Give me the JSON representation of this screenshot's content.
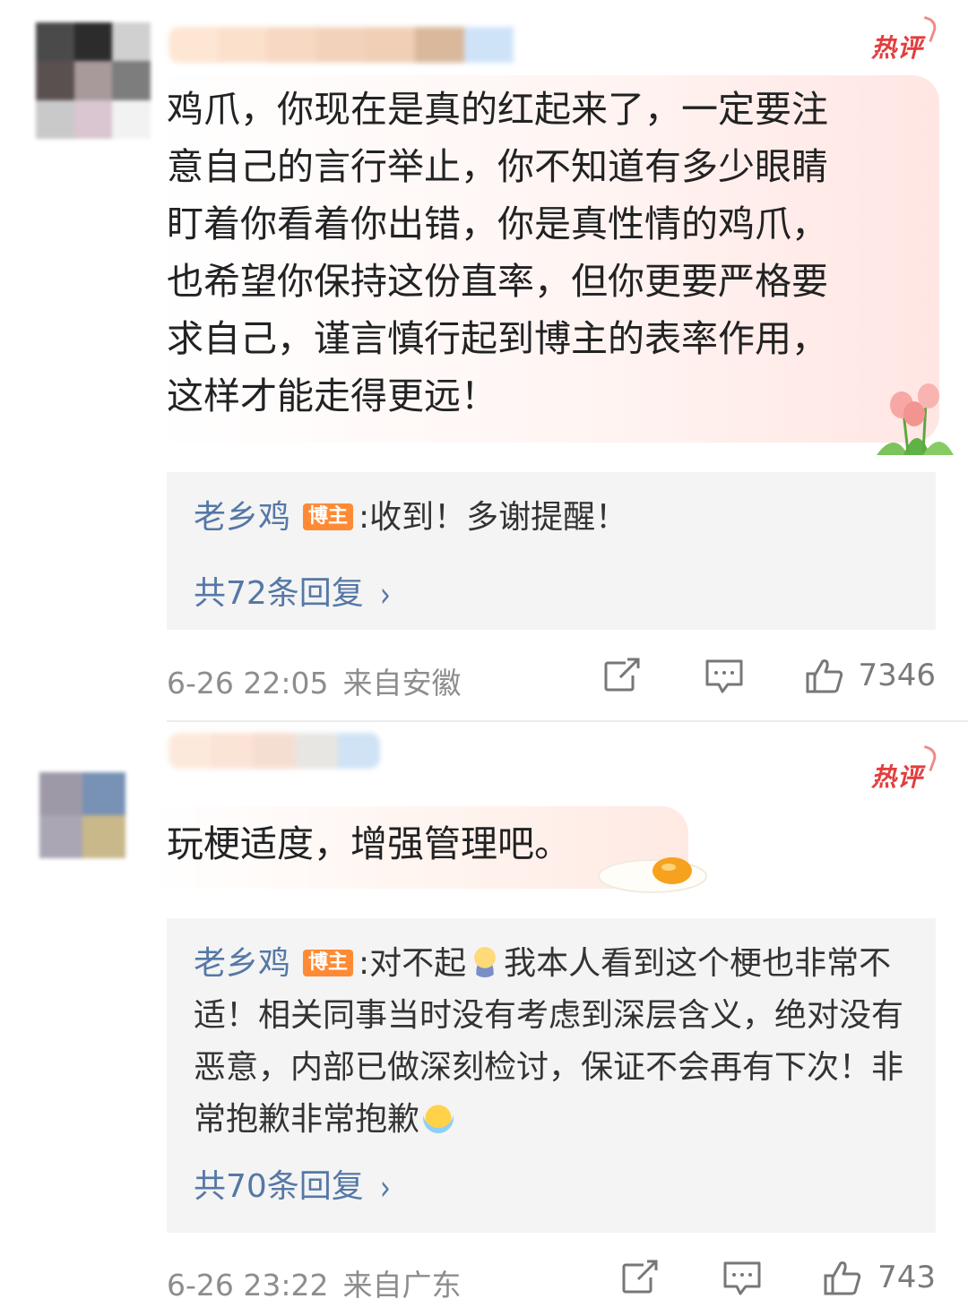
{
  "hot_badge": "热评",
  "comments": [
    {
      "avatar_tiles": [
        "#4a4a4a",
        "#2c2c2c",
        "#d0d0d0",
        "#5a5050",
        "#a89a9a",
        "#7d7d7d",
        "#c9c9c9",
        "#d9c6d0",
        "#f2f2f2"
      ],
      "username_tiles": [
        "#fde6d4",
        "#fbe0cc",
        "#f7d8c2",
        "#f3d2bb",
        "#f0cfb6",
        "#d9b89b",
        "#cfe3f8",
        "#ffffff"
      ],
      "text": "鸡爪，你现在是真的红起来了，一定要注\n意自己的言行举止，你不知道有多少眼睛\n盯着你看着你出错，你是真性情的鸡爪，\n也希望你保持这份直率，但你更要严格要\n求自己，谨言慎行起到博主的表率作用，\n这样才能走得更远！",
      "reply": {
        "author": "老乡鸡",
        "tag": "博主",
        "text": ":收到！多谢提醒！",
        "more": "共72条回复"
      },
      "time": "6-26 22:05",
      "location": "来自安徽",
      "likes": "7346"
    },
    {
      "avatar_tiles": [
        "#9e99a6",
        "#7792b5",
        "#aaa6b4",
        "#c9b88a"
      ],
      "username_tiles": [
        "#fde9dc",
        "#fbe3d6",
        "#f6ddd2",
        "#e8e6e2",
        "#cfe2f6"
      ],
      "text": "玩梗适度，增强管理吧。",
      "reply": {
        "author": "老乡鸡",
        "tag": "博主",
        "text_part1": ":对不起",
        "text_part2": "我本人看到这个梗也非常不适！相关同事当时没有考虑到深层含义，绝对没有恶意，内部已做深刻检讨，保证不会再有下次！非常抱歉非常抱歉",
        "more": "共70条回复"
      },
      "time": "6-26 23:22",
      "location": "来自广东",
      "likes": "743"
    }
  ]
}
